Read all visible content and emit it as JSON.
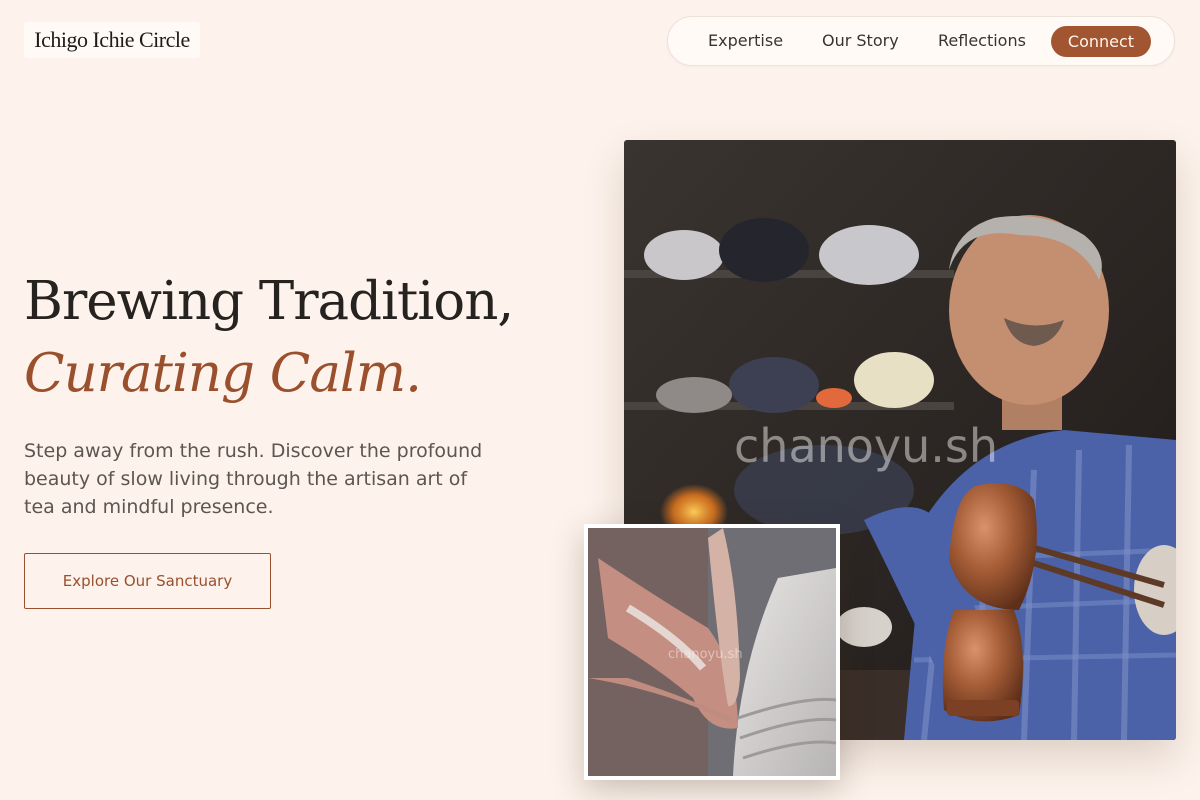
{
  "brand": {
    "logo_text": "Ichigo Ichie Circle"
  },
  "nav": {
    "items": [
      {
        "label": "Expertise"
      },
      {
        "label": "Our Story"
      },
      {
        "label": "Reflections"
      }
    ],
    "cta_label": "Connect"
  },
  "hero": {
    "title_line1": "Brewing Tradition,",
    "title_line2": "Curating Calm.",
    "lead": "Step away from the rush. Discover the profound beauty of slow living through the artisan art of tea and mindful presence.",
    "button_label": "Explore Our Sanctuary"
  },
  "images": {
    "main_watermark": "chanoyu.sh",
    "small_watermark": "chanoyu.sh"
  },
  "colors": {
    "background": "#fdf3ec",
    "accent": "#a15530",
    "text": "#262220"
  }
}
